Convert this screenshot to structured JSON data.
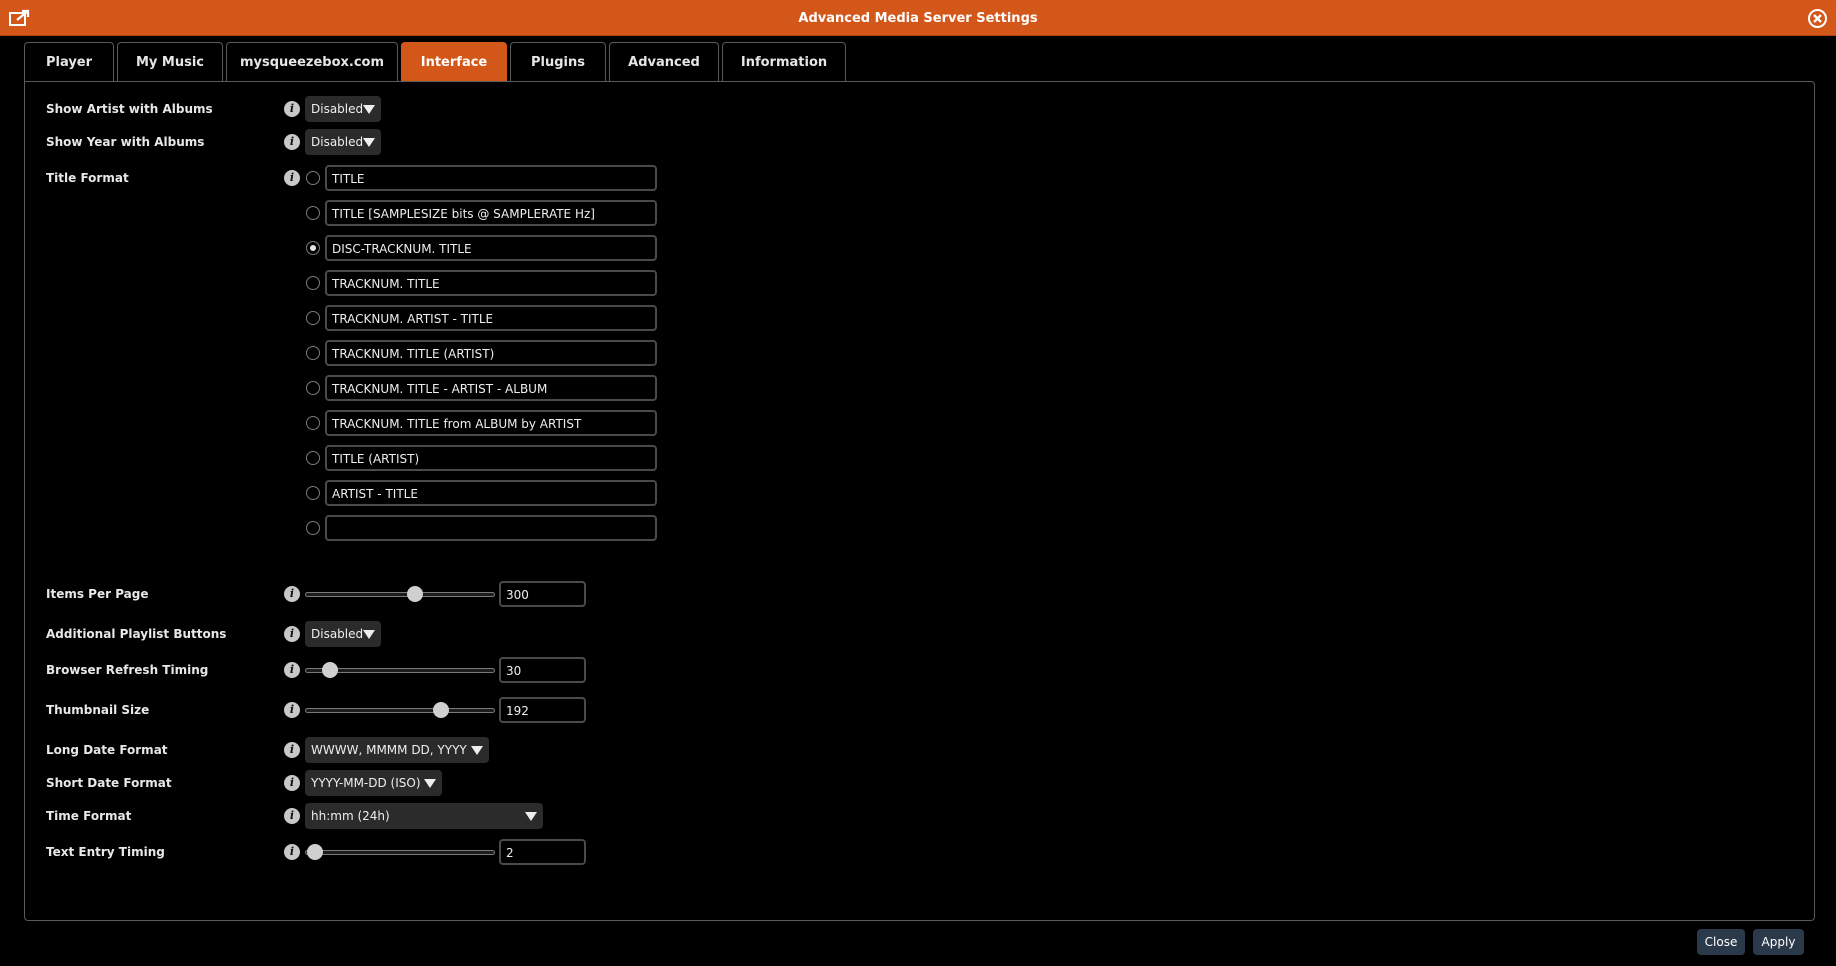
{
  "window": {
    "title": "Advanced Media Server Settings"
  },
  "tabs": [
    {
      "label": "Player"
    },
    {
      "label": "My Music"
    },
    {
      "label": "mysqueezebox.com"
    },
    {
      "label": "Interface",
      "active": true
    },
    {
      "label": "Plugins"
    },
    {
      "label": "Advanced"
    },
    {
      "label": "Information"
    }
  ],
  "settings": {
    "show_artist": {
      "label": "Show Artist with Albums",
      "value": "Disabled"
    },
    "show_year": {
      "label": "Show Year with Albums",
      "value": "Disabled"
    },
    "title_format": {
      "label": "Title Format",
      "selected_index": 2,
      "options": [
        "TITLE",
        "TITLE [SAMPLESIZE bits @ SAMPLERATE Hz]",
        "DISC-TRACKNUM. TITLE",
        "TRACKNUM. TITLE",
        "TRACKNUM. ARTIST - TITLE",
        "TRACKNUM. TITLE (ARTIST)",
        "TRACKNUM. TITLE - ARTIST - ALBUM",
        "TRACKNUM. TITLE from ALBUM by ARTIST",
        "TITLE (ARTIST)",
        "ARTIST - TITLE",
        ""
      ]
    },
    "items_per_page": {
      "label": "Items Per Page",
      "value": "300",
      "fraction": 0.58
    },
    "playlist_buttons": {
      "label": "Additional Playlist Buttons",
      "value": "Disabled"
    },
    "refresh_timing": {
      "label": "Browser Refresh Timing",
      "value": "30",
      "fraction": 0.13
    },
    "thumbnail_size": {
      "label": "Thumbnail Size",
      "value": "192",
      "fraction": 0.72
    },
    "long_date": {
      "label": "Long Date Format",
      "value": "WWWW, MMMM DD, YYYY"
    },
    "short_date": {
      "label": "Short Date Format",
      "value": "YYYY-MM-DD (ISO)"
    },
    "time_format": {
      "label": "Time Format",
      "value": "hh:mm (24h)"
    },
    "text_entry_timing": {
      "label": "Text Entry Timing",
      "value": "2",
      "fraction": 0.05
    }
  },
  "buttons": {
    "close": "Close",
    "apply": "Apply"
  },
  "colors": {
    "accent": "#d4571a",
    "background": "#000000"
  },
  "icons": {
    "title_left": "external-window-icon",
    "title_right": "close-circle-icon",
    "info": "info-icon"
  }
}
